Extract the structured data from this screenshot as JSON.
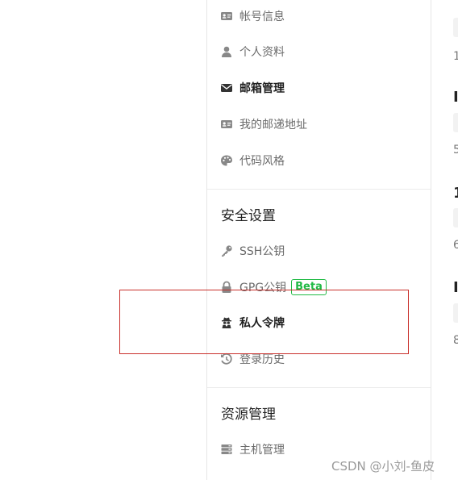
{
  "sidebar": {
    "items_top": [
      {
        "label": "帐号信息",
        "icon": "id-card-icon"
      },
      {
        "label": "个人资料",
        "icon": "user-icon"
      },
      {
        "label": "邮箱管理",
        "icon": "envelope-icon"
      },
      {
        "label": "我的邮递地址",
        "icon": "address-card-icon"
      },
      {
        "label": "代码风格",
        "icon": "palette-icon"
      }
    ],
    "security": {
      "title": "安全设置",
      "items": [
        {
          "label": "SSH公钥",
          "icon": "key-icon"
        },
        {
          "label": "GPG公钥",
          "icon": "lock-icon",
          "badge": "Beta"
        },
        {
          "label": "私人令牌",
          "icon": "user-secret-icon"
        },
        {
          "label": "登录历史",
          "icon": "history-icon"
        }
      ]
    },
    "resources": {
      "title": "资源管理",
      "items": [
        {
          "label": "主机管理",
          "icon": "server-icon"
        }
      ]
    }
  },
  "right_fragments": {
    "heading_1": "I",
    "heading_2": "1",
    "heading_3": "I",
    "num_1": "1",
    "num_2": "5",
    "num_3": "6",
    "num_4": "8"
  },
  "watermark": "CSDN @小刘-鱼皮",
  "colors": {
    "badge_green": "#21ba45",
    "highlight_red": "#c9302c",
    "active_text": "#1f1f1f",
    "muted_text": "#6b6b6b"
  }
}
